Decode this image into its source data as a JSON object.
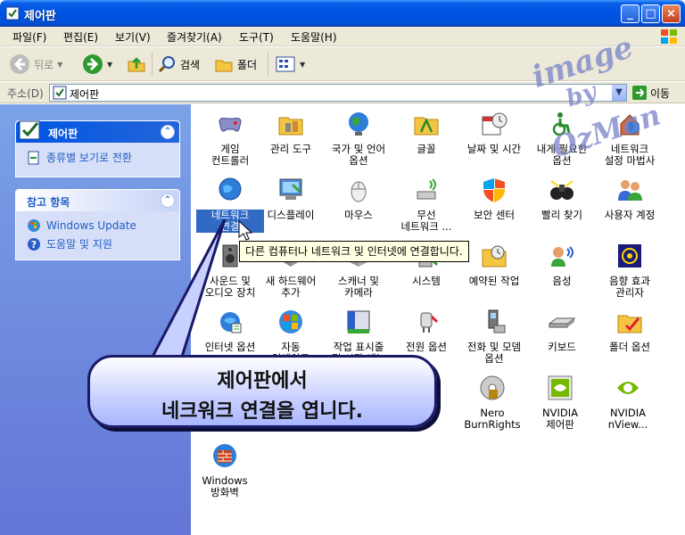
{
  "window": {
    "title": "제어판"
  },
  "menu": [
    "파일(F)",
    "편집(E)",
    "보기(V)",
    "즐겨찾기(A)",
    "도구(T)",
    "도움말(H)"
  ],
  "toolbar": {
    "back": "뒤로",
    "search": "검색",
    "folders": "폴더"
  },
  "address": {
    "label": "주소(D)",
    "value": "제어판",
    "go": "이동"
  },
  "left_panel": {
    "control_panel": {
      "title": "제어판",
      "items": [
        "종류별 보기로 전환"
      ]
    },
    "see_also": {
      "title": "참고 항목",
      "items": [
        "Windows Update",
        "도움말 및 지원"
      ]
    }
  },
  "items": [
    {
      "label": "게임\n컨트롤러",
      "icon": "game-controller-icon"
    },
    {
      "label": "관리 도구",
      "icon": "admin-tools-icon"
    },
    {
      "label": "국가 및 언어\n옵션",
      "icon": "globe-icon"
    },
    {
      "label": "글꼴",
      "icon": "fonts-folder-icon"
    },
    {
      "label": "날짜 및 시간",
      "icon": "calendar-clock-icon"
    },
    {
      "label": "내게 필요한\n옵션",
      "icon": "accessibility-icon"
    },
    {
      "label": "네트워크\n설정 마법사",
      "icon": "network-wizard-icon"
    },
    {
      "label": "네트워크\n연결",
      "icon": "network-globe-icon"
    },
    {
      "label": "디스플레이",
      "icon": "display-icon"
    },
    {
      "label": "마우스",
      "icon": "mouse-icon"
    },
    {
      "label": "무선\n네트워크 ...",
      "icon": "wireless-icon"
    },
    {
      "label": "보안 센터",
      "icon": "shield-icon"
    },
    {
      "label": "빨리 찾기",
      "icon": "binoculars-icon"
    },
    {
      "label": "사용자 계정",
      "icon": "users-icon"
    },
    {
      "label": "사운드 및\n오디오 장치",
      "icon": "speaker-icon"
    },
    {
      "label": "새 하드웨어\n추가",
      "icon": "hardware-icon"
    },
    {
      "label": "스캐너 및\n카메라",
      "icon": "scanner-icon"
    },
    {
      "label": "시스템",
      "icon": "system-icon"
    },
    {
      "label": "예약된 작업",
      "icon": "scheduled-task-icon"
    },
    {
      "label": "음성",
      "icon": "speech-icon"
    },
    {
      "label": "음향 효과\n관리자",
      "icon": "sound-effect-icon"
    },
    {
      "label": "인터넷 옵션",
      "icon": "internet-options-icon"
    },
    {
      "label": "자동\n업데이트",
      "icon": "windows-update-icon"
    },
    {
      "label": "작업 표시줄\n및 시작 메뉴",
      "icon": "taskbar-icon"
    },
    {
      "label": "전원 옵션",
      "icon": "power-icon"
    },
    {
      "label": "전화 및 모뎀\n옵션",
      "icon": "phone-icon"
    },
    {
      "label": "키보드",
      "icon": "keyboard-icon"
    },
    {
      "label": "폴더 옵션",
      "icon": "folder-options-icon"
    },
    {
      "label": "Nero\nBurnRights",
      "icon": "nero-icon"
    },
    {
      "label": "NVIDIA\n제어판",
      "icon": "nvidia-icon"
    },
    {
      "label": "NVIDIA\nnView...",
      "icon": "nvidia-nview-icon"
    },
    {
      "label": "Windows\n방화벽",
      "icon": "firewall-icon"
    }
  ],
  "tooltip": "다른 컴퓨터나 네트워크 및 인터넷에 연결합니다.",
  "watermark": [
    "image",
    "by",
    "OzMan"
  ],
  "callout": [
    "제어판에서",
    "네크워크 연결을 엽니다."
  ]
}
